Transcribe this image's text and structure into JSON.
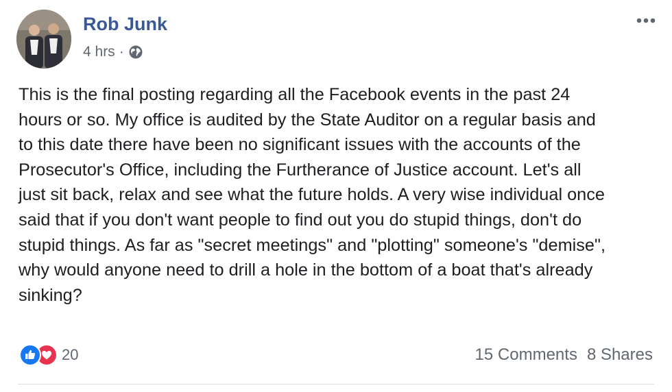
{
  "post": {
    "author": "Rob Junk",
    "time": "4 hrs",
    "separator": "·",
    "privacy_icon": "globe-icon",
    "body": "This is the final posting regarding all the Facebook events in the past 24\nhours or so. My office is audited by the State Auditor on a regular basis and\nto this date there have been no significant issues with the accounts of the\nProsecutor's Office, including the Furtherance of Justice account. Let's all\njust sit back, relax and see what the future holds. A very wise individual once\nsaid that if you don't want people to find out you do stupid things, don't do\nstupid things. As far as \"secret meetings\" and \"plotting\" someone's \"demise\",\nwhy would anyone need to drill a hole in the bottom of a boat that's already\nsinking?",
    "reaction_count": "20",
    "comments": "15 Comments",
    "shares": "8 Shares"
  },
  "colors": {
    "author_link": "#385898",
    "meta_text": "#616770",
    "like_blue": "#1877f2",
    "love_red": "#e8334f"
  }
}
